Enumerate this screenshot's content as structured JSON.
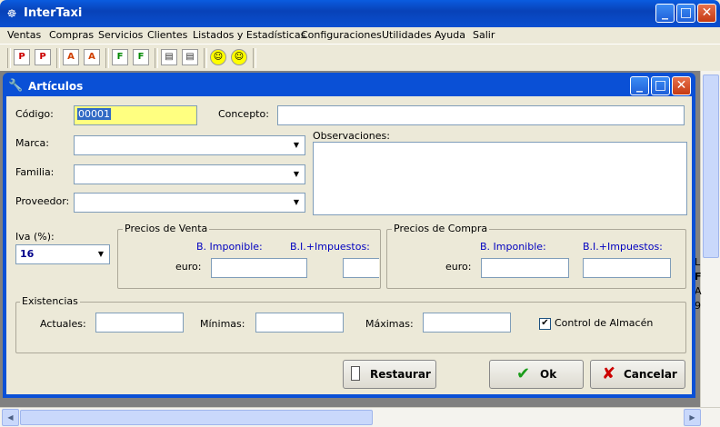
{
  "app": {
    "title": "InterTaxi",
    "icon": "taxi-icon"
  },
  "window_buttons": {
    "minimize": "_",
    "maximize": "□",
    "close": "✕"
  },
  "menu": [
    "Ventas",
    "Compras",
    "Servicios",
    "Clientes",
    "Listados y Estadísticas",
    "Configuraciones",
    "Utilidades",
    "Ayuda",
    "Salir"
  ],
  "toolbar": {
    "icons": [
      "P",
      "P",
      "A",
      "A",
      "F",
      "F",
      "▤",
      "▤",
      "☺",
      "☺"
    ]
  },
  "background_text": [
    "L",
    "F",
    "A",
    "9"
  ],
  "dialog": {
    "title": "Artículos",
    "icon": "wrench-icon",
    "codigo_label": "Código:",
    "codigo_value": "00001",
    "concepto_label": "Concepto:",
    "concepto_value": "",
    "marca_label": "Marca:",
    "familia_label": "Familia:",
    "proveedor_label": "Proveedor:",
    "observaciones_label": "Observaciones:",
    "iva_label": "Iva (%):",
    "iva_value": "16",
    "ventas": {
      "title": "Precios de Venta",
      "col1": "B. Imponible:",
      "col2": "B.I.+Impuestos:",
      "row_label": "euro:"
    },
    "compras": {
      "title": "Precios de Compra",
      "col1": "B. Imponible:",
      "col2": "B.I.+Impuestos:",
      "row_label": "euro:"
    },
    "existencias": {
      "title": "Existencias",
      "actuales": "Actuales:",
      "minimas": "Mínimas:",
      "maximas": "Máximas:",
      "control": "Control de Almacén",
      "control_checked": true
    },
    "buttons": {
      "restaurar": "Restaurar",
      "ok": "Ok",
      "cancelar": "Cancelar"
    }
  },
  "colors": {
    "titlebar": "#0a50d6",
    "codigo_bg": "#ffff80",
    "link_blue": "#0000c0"
  }
}
